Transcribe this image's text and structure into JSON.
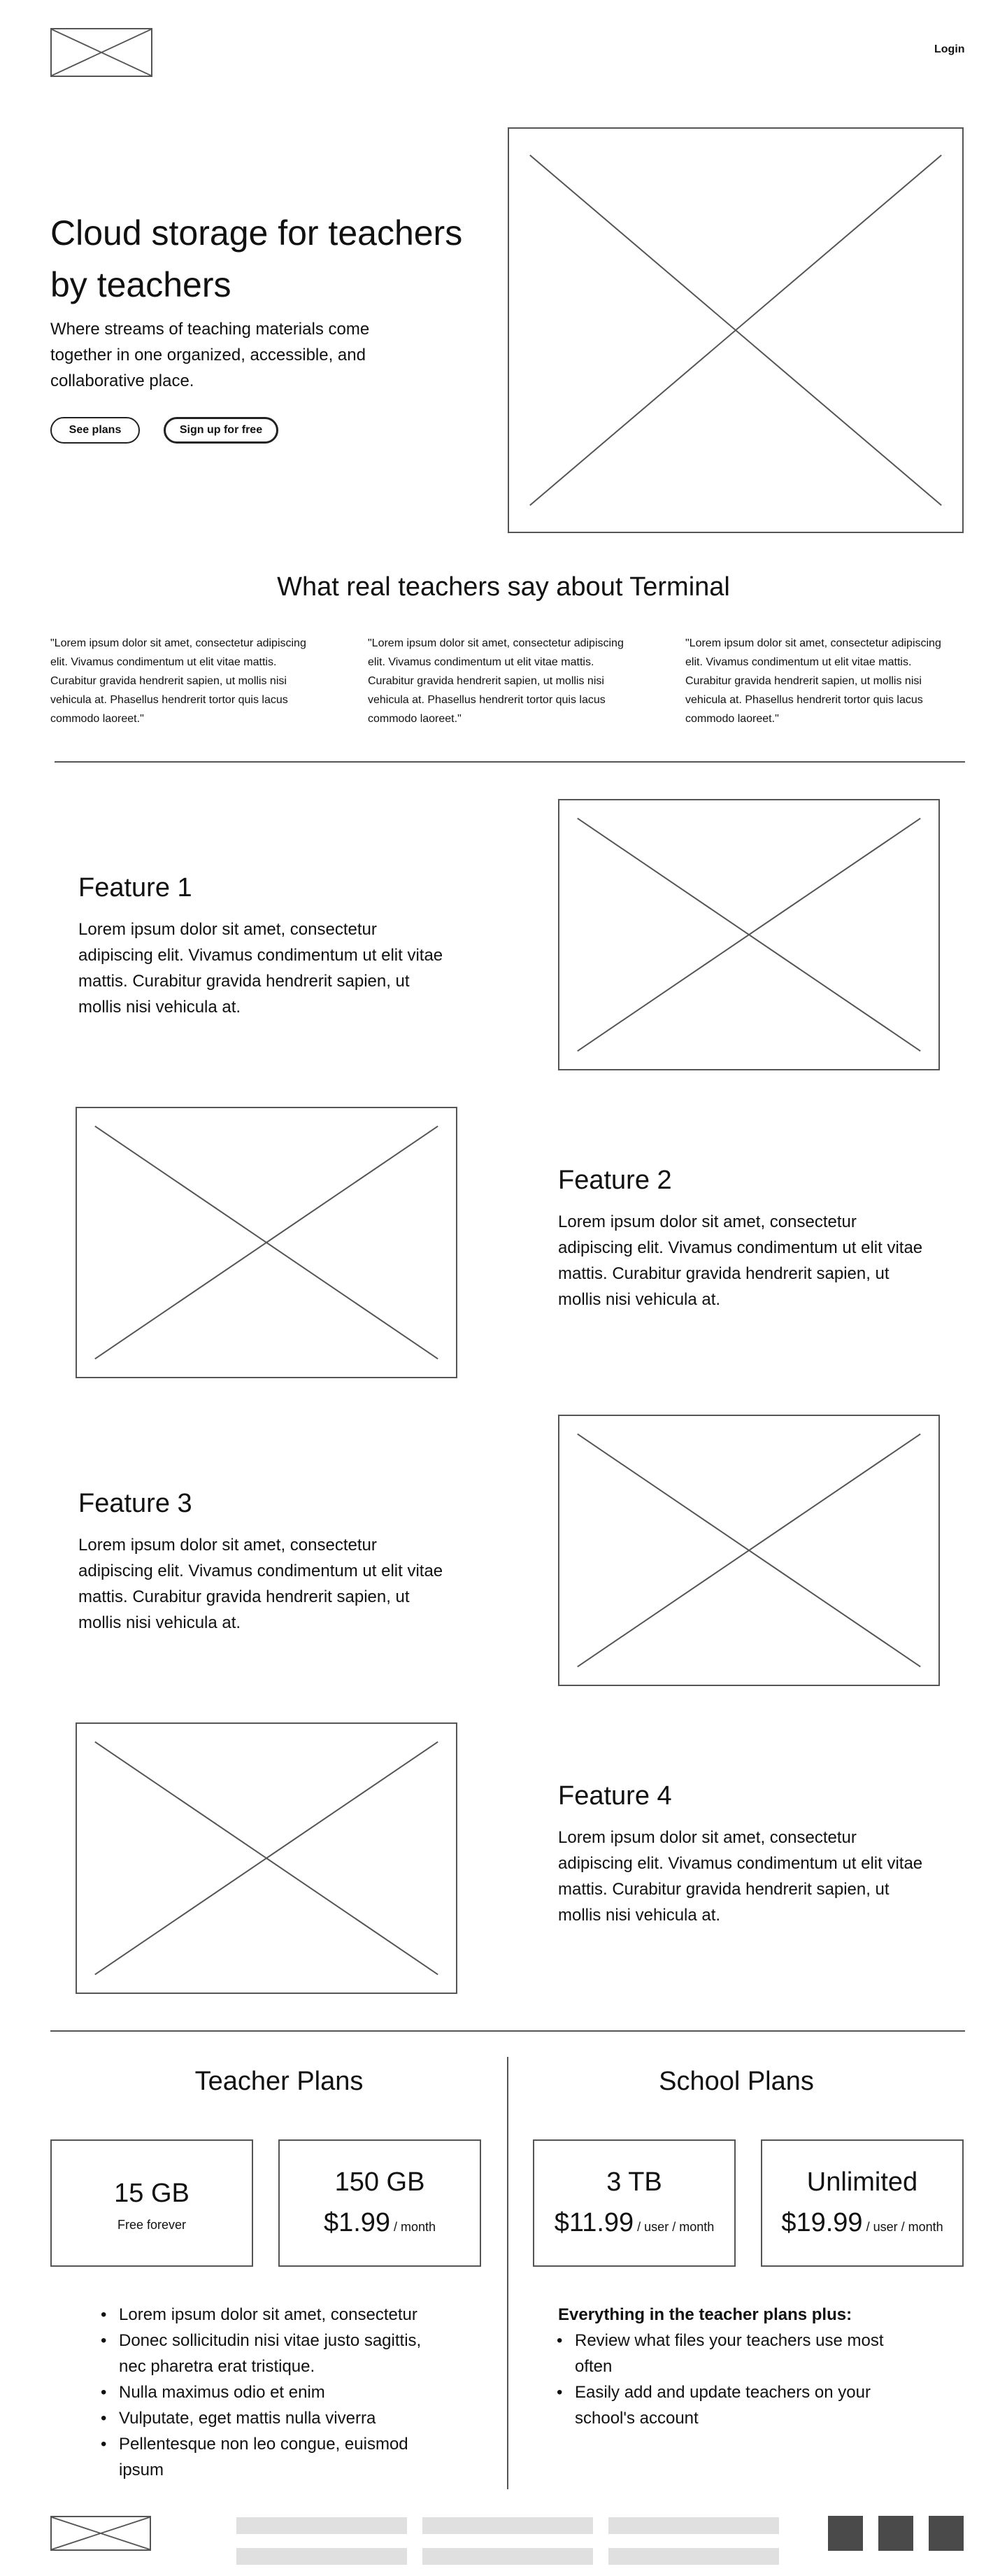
{
  "header": {
    "login_label": "Login"
  },
  "hero": {
    "title_line1": "Cloud storage for teachers",
    "title_line2": "by teachers",
    "subtitle_line1": "Where streams of teaching materials come",
    "subtitle_line2": "together in one organized, accessible, and",
    "subtitle_line3": "collaborative place.",
    "see_plans_label": "See plans",
    "signup_label": "Sign up for free"
  },
  "testimonials": {
    "heading": "What real teachers say about Terminal",
    "quotes": [
      {
        "lines": [
          "\"Lorem ipsum dolor sit amet, consectetur adipiscing",
          "elit. Vivamus condimentum ut elit vitae mattis.",
          "Curabitur gravida hendrerit sapien, ut mollis nisi",
          "vehicula at. Phasellus hendrerit tortor quis lacus",
          "commodo laoreet.\""
        ]
      },
      {
        "lines": [
          "\"Lorem ipsum dolor sit amet, consectetur adipiscing",
          "elit. Vivamus condimentum ut elit vitae mattis.",
          "Curabitur gravida hendrerit sapien, ut mollis nisi",
          "vehicula at. Phasellus hendrerit tortor quis lacus",
          "commodo laoreet.\""
        ]
      },
      {
        "lines": [
          "\"Lorem ipsum dolor sit amet, consectetur adipiscing",
          "elit. Vivamus condimentum ut elit vitae mattis.",
          "Curabitur gravida hendrerit sapien, ut mollis nisi",
          "vehicula at. Phasellus hendrerit tortor quis lacus",
          "commodo laoreet.\""
        ]
      }
    ]
  },
  "features": [
    {
      "title": "Feature 1",
      "lines": [
        "Lorem ipsum dolor sit amet, consectetur",
        "adipiscing elit. Vivamus condimentum ut elit vitae",
        "mattis. Curabitur gravida hendrerit sapien, ut",
        "mollis nisi vehicula at."
      ]
    },
    {
      "title": "Feature 2",
      "lines": [
        "Lorem ipsum dolor sit amet, consectetur",
        "adipiscing elit. Vivamus condimentum ut elit vitae",
        "mattis. Curabitur gravida hendrerit sapien, ut",
        "mollis nisi vehicula at."
      ]
    },
    {
      "title": "Feature 3",
      "lines": [
        "Lorem ipsum dolor sit amet, consectetur",
        "adipiscing elit. Vivamus condimentum ut elit vitae",
        "mattis. Curabitur gravida hendrerit sapien, ut",
        "mollis nisi vehicula at."
      ]
    },
    {
      "title": "Feature 4",
      "lines": [
        "Lorem ipsum dolor sit amet, consectetur",
        "adipiscing elit. Vivamus condimentum ut elit vitae",
        "mattis. Curabitur gravida hendrerit sapien, ut",
        "mollis nisi vehicula at."
      ]
    }
  ],
  "teacher_plans": {
    "heading": "Teacher Plans",
    "cards": [
      {
        "size": "15 GB",
        "note": "Free forever"
      },
      {
        "size": "150 GB",
        "price": "$1.99",
        "unit": " / month"
      }
    ],
    "bullets": [
      [
        "Lorem ipsum dolor sit amet, consectetur"
      ],
      [
        "Donec sollicitudin nisi vitae justo sagittis,",
        "nec pharetra erat tristique."
      ],
      [
        "Nulla maximus odio et enim"
      ],
      [
        "Vulputate, eget mattis nulla viverra"
      ],
      [
        "Pellentesque non leo congue, euismod",
        "ipsum"
      ]
    ]
  },
  "school_plans": {
    "heading": "School Plans",
    "cards": [
      {
        "size": "3 TB",
        "price": "$11.99",
        "unit": " / user / month"
      },
      {
        "size": "Unlimited",
        "price": "$19.99",
        "unit": " / user / month"
      }
    ],
    "intro": "Everything in the teacher plans plus:",
    "bullets": [
      [
        "Review what files your teachers use most",
        "often"
      ],
      [
        "Easily add and update teachers on your",
        "school's account"
      ]
    ]
  },
  "colors": {
    "line": "#555555",
    "footer_bar": "#e0e0e0",
    "footer_square": "#4a4a4a"
  }
}
